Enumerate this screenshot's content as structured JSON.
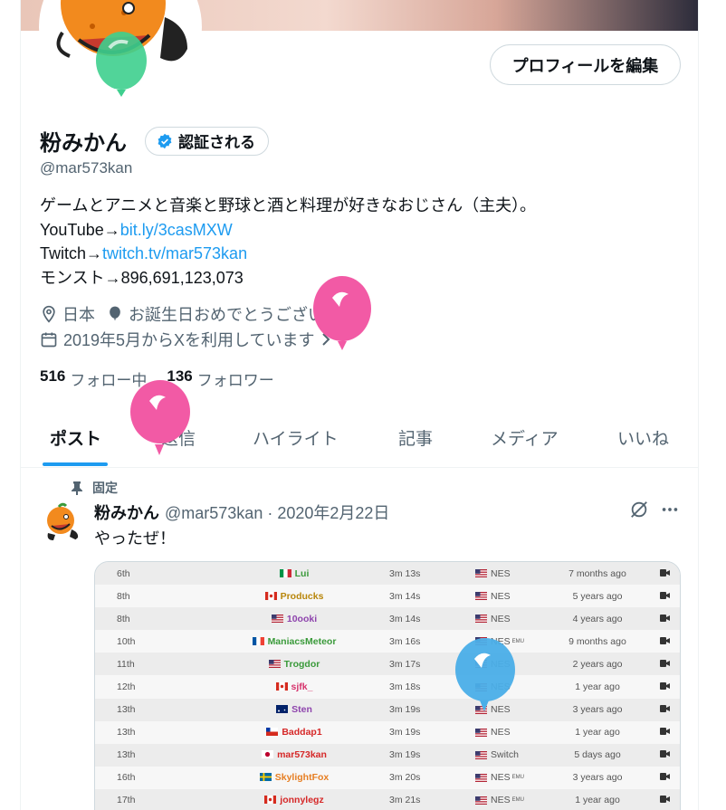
{
  "profile": {
    "edit_button": "プロフィールを編集",
    "name": "粉みかん",
    "verify_button": "認証される",
    "handle": "@mar573kan",
    "bio_line1": "ゲームとアニメと音楽と野球と酒と料理が好きなおじさん（主夫）。",
    "bio_youtube_prefix": "YouTube→",
    "bio_youtube_link": "bit.ly/3casMXW",
    "bio_twitch_prefix": "Twitch→",
    "bio_twitch_link": "twitch.tv/mar573kan",
    "bio_monst": "モンスト→896,691,123,073",
    "location": "日本",
    "birthday": "お誕生日おめでとうございます。",
    "joined": "2019年5月からXを利用しています",
    "following_count": "516",
    "following_label": "フォロー中",
    "followers_count": "136",
    "followers_label": "フォロワー"
  },
  "tabs": [
    {
      "label": "ポスト"
    },
    {
      "label": "返信"
    },
    {
      "label": "ハイライト"
    },
    {
      "label": "記事"
    },
    {
      "label": "メディア"
    },
    {
      "label": "いいね"
    }
  ],
  "post": {
    "pinned_label": "固定",
    "author_name": "粉みかん",
    "author_meta": "@mar573kan · 2020年2月22日",
    "text": "やったぜ！",
    "leaderboard": [
      {
        "rank": "6th",
        "player": "Lui",
        "player_color": "#3a9a3a",
        "flag": "it",
        "time": "3m 13s",
        "platform": "NES",
        "emu": "",
        "date": "7 months ago"
      },
      {
        "rank": "8th",
        "player": "Producks",
        "player_color": "#b8860b",
        "flag": "ca",
        "time": "3m 14s",
        "platform": "NES",
        "emu": "",
        "date": "5 years ago"
      },
      {
        "rank": "8th",
        "player": "10ooki",
        "player_color": "#8e44ad",
        "flag": "us",
        "time": "3m 14s",
        "platform": "NES",
        "emu": "",
        "date": "4 years ago"
      },
      {
        "rank": "10th",
        "player": "ManiacsMeteor",
        "player_color": "#3a9a3a",
        "flag": "fr",
        "time": "3m 16s",
        "platform": "NES",
        "emu": "EMU",
        "date": "9 months ago"
      },
      {
        "rank": "11th",
        "player": "Trogdor",
        "player_color": "#3a9a3a",
        "flag": "us",
        "time": "3m 17s",
        "platform": "NES",
        "emu": "",
        "date": "2 years ago"
      },
      {
        "rank": "12th",
        "player": "sjfk_",
        "player_color": "#d6336c",
        "flag": "ca",
        "time": "3m 18s",
        "platform": "NES",
        "emu": "",
        "date": "1 year ago"
      },
      {
        "rank": "13th",
        "player": "Sten",
        "player_color": "#8e44ad",
        "flag": "au",
        "time": "3m 19s",
        "platform": "NES",
        "emu": "",
        "date": "3 years ago"
      },
      {
        "rank": "13th",
        "player": "Baddap1",
        "player_color": "#d62828",
        "flag": "cl",
        "time": "3m 19s",
        "platform": "NES",
        "emu": "",
        "date": "1 year ago"
      },
      {
        "rank": "13th",
        "player": "mar573kan",
        "player_color": "#d62828",
        "flag": "jp",
        "time": "3m 19s",
        "platform": "Switch",
        "emu": "",
        "date": "5 days ago"
      },
      {
        "rank": "16th",
        "player": "SkylightFox",
        "player_color": "#e67e22",
        "flag": "se",
        "time": "3m 20s",
        "platform": "NES",
        "emu": "EMU",
        "date": "3 years ago"
      },
      {
        "rank": "17th",
        "player": "jonnylegz",
        "player_color": "#d62828",
        "flag": "ca",
        "time": "3m 21s",
        "platform": "NES",
        "emu": "EMU",
        "date": "1 year ago"
      }
    ]
  },
  "colors": {
    "link": "#1d9bf0",
    "balloon_pink": "#f25aa5",
    "balloon_blue": "#4aaee8",
    "balloon_green": "#3ecf8e"
  }
}
